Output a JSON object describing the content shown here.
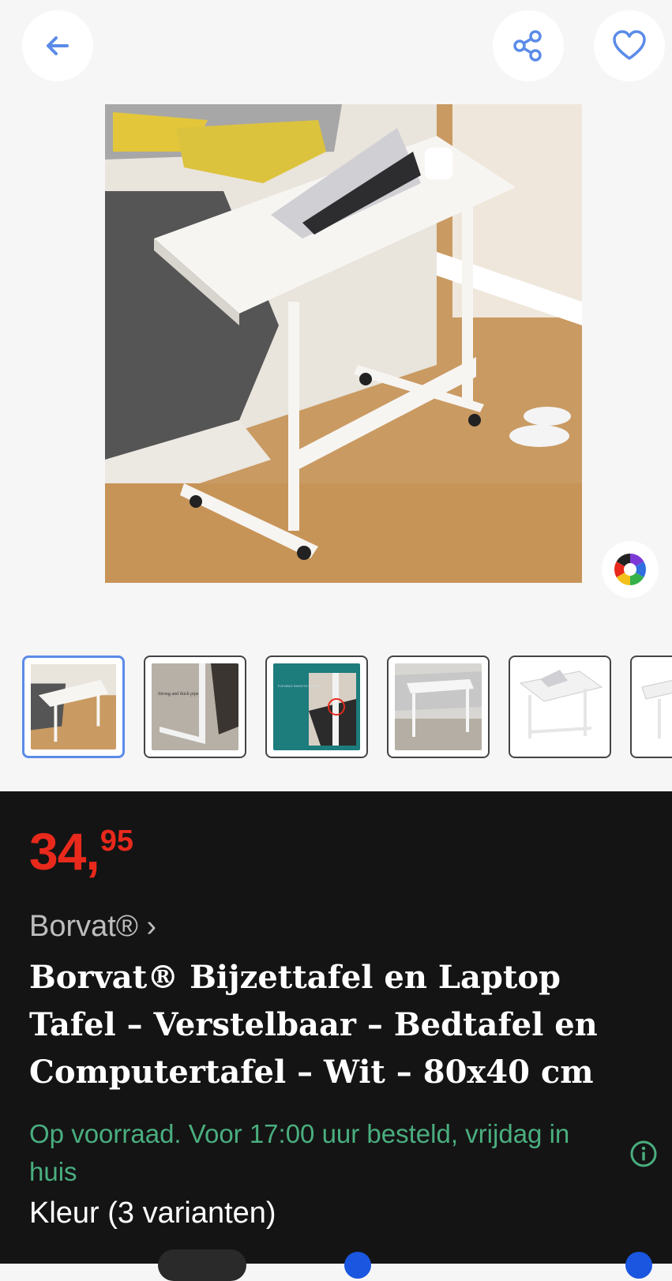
{
  "header": {
    "back_icon": "arrow-left-icon",
    "share_icon": "share-icon",
    "favorite_icon": "heart-icon",
    "accent": "#5b8be8"
  },
  "gallery": {
    "thumbnail_count_visible": 6,
    "selected_index": 0,
    "thumb_caption_1": "Strong and thick pipe",
    "thumb_caption_2": "FLEXIBLE SMOOTH MOVING"
  },
  "product": {
    "price_euros": "34",
    "price_comma": ",",
    "price_cents": "95",
    "price_color": "#e8291c",
    "brand_link": "Borvat® ›",
    "title": "Borvat® Bijzettafel en Laptop Tafel – Verstelbaar – Bedtafel en Computertafel – Wit – 80x40 cm",
    "stock": "Op voorraad. Voor 17:00 uur besteld, vrijdag in huis",
    "stock_color": "#4aae7f",
    "variants": "Kleur (3 varianten)"
  }
}
